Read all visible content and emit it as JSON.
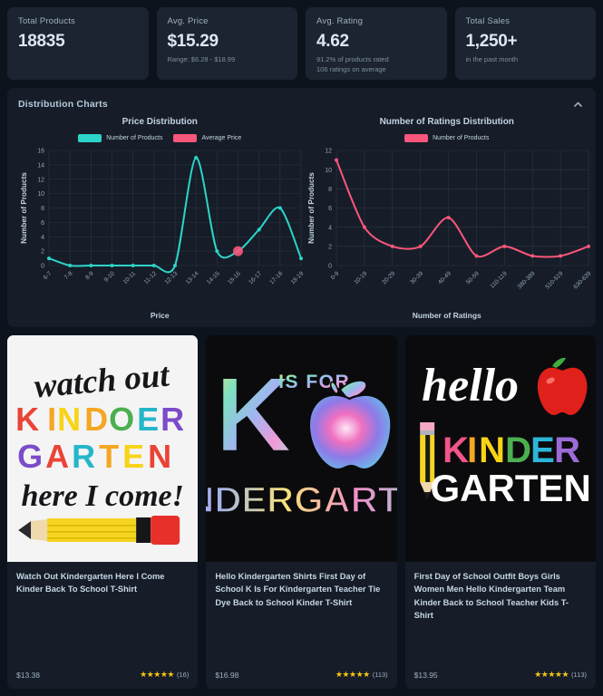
{
  "stats": [
    {
      "label": "Total Products",
      "value": "18835",
      "sub": ""
    },
    {
      "label": "Avg. Price",
      "value": "$15.29",
      "sub": "Range: $6.28 - $18.99"
    },
    {
      "label": "Avg. Rating",
      "value": "4.62",
      "sub": "91.2% of products rated\n106 ratings on average"
    },
    {
      "label": "Total Sales",
      "value": "1,250+",
      "sub": "in the past month"
    }
  ],
  "charts_panel": {
    "title": "Distribution Charts",
    "collapse_icon": "chevron-up-icon"
  },
  "chart_data": [
    {
      "type": "line",
      "title": "Price Distribution",
      "xlabel": "Price",
      "ylabel": "Number of Products",
      "categories": [
        "6-7",
        "7-8",
        "8-9",
        "9-10",
        "10-11",
        "11-12",
        "12-13",
        "13-14",
        "14-15",
        "15-16",
        "16-17",
        "17-18",
        "18-19"
      ],
      "series": [
        {
          "name": "Number of Products",
          "color": "#2dd4c8",
          "values": [
            1,
            0,
            0,
            0,
            0,
            0,
            0,
            15,
            2,
            2,
            5,
            8,
            1
          ]
        },
        {
          "name": "Average Price",
          "color": "#f8567a",
          "values": [
            null,
            null,
            null,
            null,
            null,
            null,
            null,
            null,
            null,
            2,
            null,
            null,
            null
          ]
        }
      ],
      "ylim": [
        0,
        16
      ],
      "yticks": [
        0,
        2,
        4,
        6,
        8,
        10,
        12,
        14,
        16
      ],
      "grid": true,
      "legend_position": "top"
    },
    {
      "type": "line",
      "title": "Number of Ratings Distribution",
      "xlabel": "Number of Ratings",
      "ylabel": "Number of Products",
      "categories": [
        "0-9",
        "10-19",
        "20-29",
        "30-39",
        "40-49",
        "50-59",
        "110-119",
        "380-389",
        "510-519",
        "630-639"
      ],
      "series": [
        {
          "name": "Number of Products",
          "color": "#f8567a",
          "values": [
            11,
            4,
            2,
            2,
            5,
            1,
            2,
            1,
            1,
            2
          ]
        }
      ],
      "ylim": [
        0,
        12
      ],
      "yticks": [
        0,
        2,
        4,
        6,
        8,
        10,
        12
      ],
      "grid": true,
      "legend_position": "top"
    }
  ],
  "products": [
    {
      "title": "Watch Out Kindergarten Here I Come Kinder Back To School T-Shirt",
      "price": "$13.38",
      "stars": "★★★★★",
      "rating_count": "(16)",
      "art_text": {
        "l1": "watch out",
        "l2": "KINDER",
        "l3": "GARTEN",
        "l4": "here I come!"
      }
    },
    {
      "title": "Hello Kindergarten Shirts First Day of School K Is For Kindergarten Teacher Tie Dye Back to School Kinder T-Shirt",
      "price": "$16.98",
      "stars": "★★★★★",
      "rating_count": "(113)",
      "art_text": {
        "l1": "K",
        "l2": "IS FOR",
        "l3": "KINDERGARTEN"
      }
    },
    {
      "title": "First Day of School Outfit Boys Girls Women Men Hello Kindergarten Team Kinder Back to School Teacher Kids T-Shirt",
      "price": "$13.95",
      "stars": "★★★★★",
      "rating_count": "(113)",
      "art_text": {
        "l1": "hello",
        "l2": "KINDER",
        "l3": "GARTEN"
      }
    }
  ],
  "colors": {
    "page_bg": "#0d131c",
    "card_bg": "#1b2430",
    "panel_bg": "#161d28",
    "teal": "#2dd4c8",
    "pink": "#f8567a",
    "star": "#f5c518"
  }
}
